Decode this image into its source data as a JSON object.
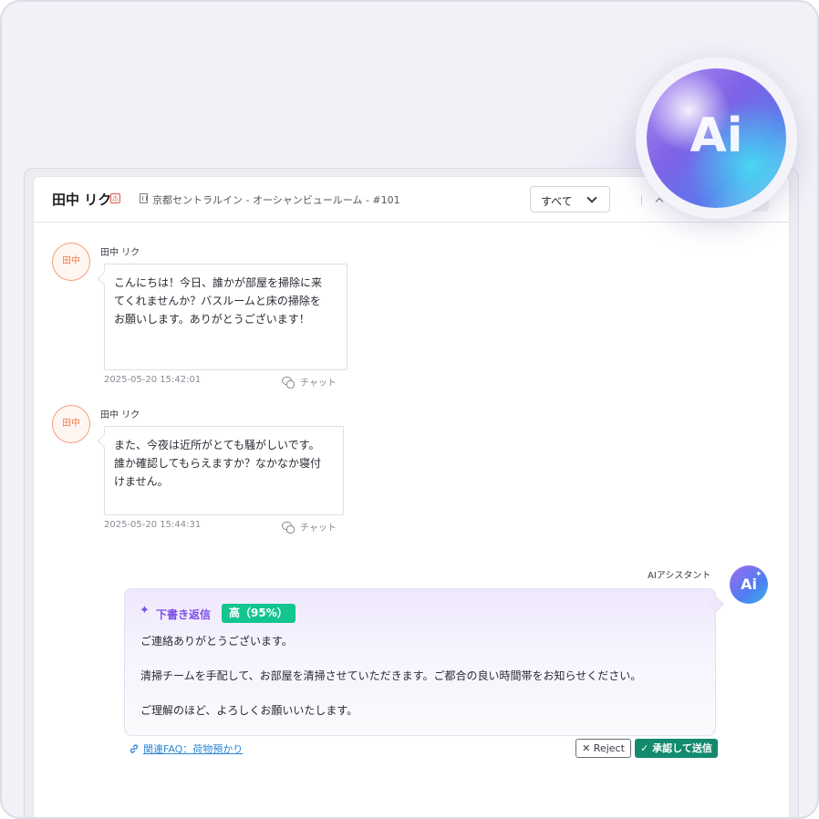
{
  "header": {
    "guest_name": "田中 リク",
    "guest_badge": "⚠",
    "room": "京都セントラルイン - オーシャンビュールーム - #101",
    "filter_value": "すべて"
  },
  "messages": [
    {
      "avatar": "田中",
      "sender": "田中 リク",
      "lines": [
        "こんにちは！今日、誰かが部屋を掃除に来",
        "てくれませんか？バスルームと床の掃除を",
        "お願いします。ありがとうございます！"
      ],
      "time": "2025-05-20 15:42:01",
      "channel": "チャット"
    },
    {
      "avatar": "田中",
      "sender": "田中 リク",
      "lines": [
        "また、今夜は近所がとても騒がしいです。",
        "誰か確認してもらえますか？なかなか寝付",
        "けません。"
      ],
      "time": "2025-05-20 15:44:31",
      "channel": "チャット"
    }
  ],
  "ai": {
    "label": "AIアシスタント",
    "avatar": "Ai",
    "avatar_spark": "✦",
    "orb_text": "Ai",
    "draft_title": "下書き返信",
    "confidence": "高（95%）",
    "body": [
      "ご連絡ありがとうございます。",
      "清掃チームを手配して、お部屋を清掃させていただきます。ご都合の良い時間帯をお知らせください。",
      "ご理解のほど、よろしくお願いいたします。"
    ],
    "faq_link": "関連FAQ：荷物預かり",
    "reject_label": "✕ Reject",
    "approve_label": "✓ 承認して送信"
  },
  "colors": {
    "accent_purple": "#7d4fe8",
    "confidence_green": "#13c58f",
    "approve_green": "#138a6d",
    "link_blue": "#2f87d6",
    "avatar_orange": "#ef7b4e"
  }
}
